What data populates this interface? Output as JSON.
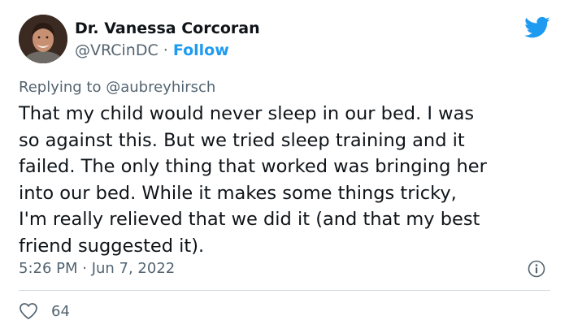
{
  "author": {
    "display_name": "Dr. Vanessa Corcoran",
    "handle": "@VRCinDC",
    "separator": "·",
    "follow_label": "Follow"
  },
  "reply": {
    "prefix": "Replying to",
    "handle": "@aubreyhirsch"
  },
  "body": {
    "lines": [
      "That my child would never sleep in our bed. I was",
      "so against this. But we tried sleep training and it",
      "failed. The only thing that worked was bringing her",
      "into our bed. While it makes some things tricky,",
      "I'm really relieved that we did it (and that my best",
      "friend suggested it)."
    ]
  },
  "meta": {
    "timestamp": "5:26 PM · Jun 7, 2022"
  },
  "actions": {
    "like_count": "64"
  },
  "colors": {
    "brand": "#1d9bf0",
    "text_primary": "#0f1419",
    "text_secondary": "#536471",
    "divider": "#cfd9de"
  },
  "icons": {
    "logo": "twitter-bird-icon",
    "info": "info-icon",
    "like": "heart-icon"
  }
}
